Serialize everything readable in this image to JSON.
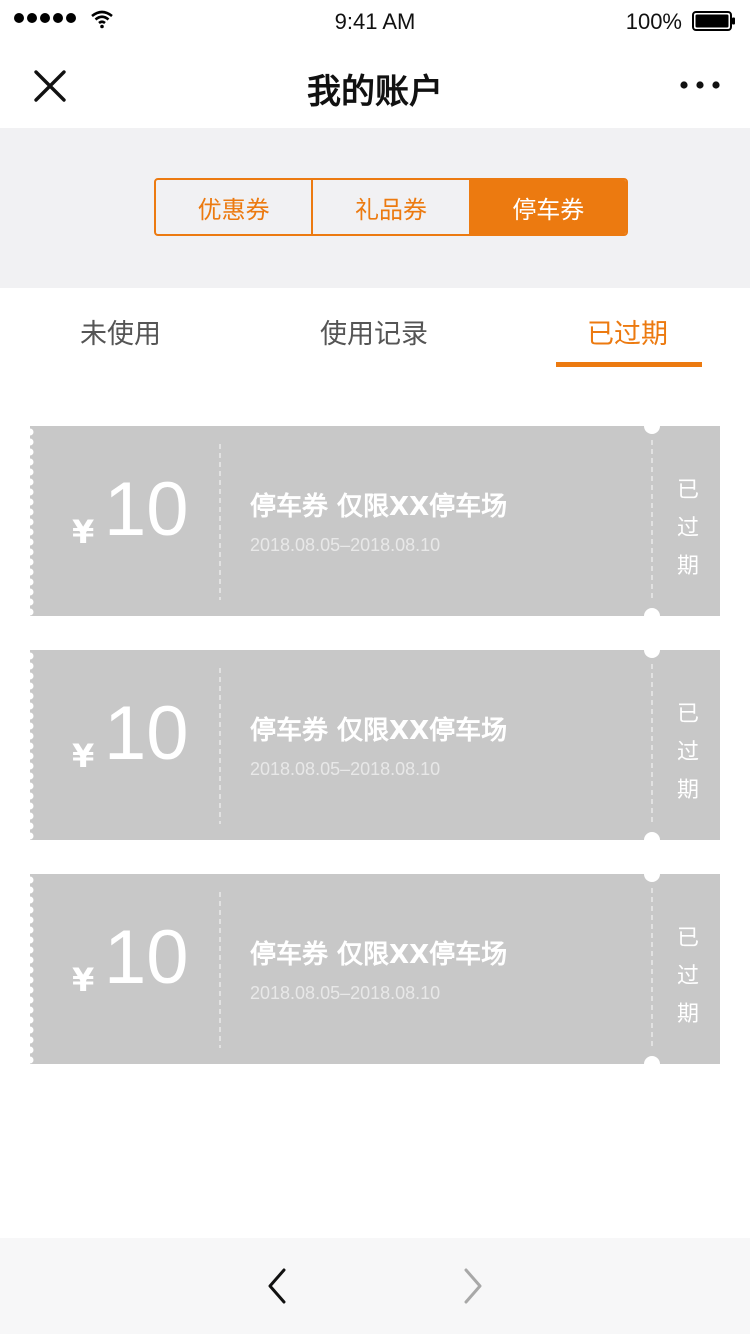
{
  "status_bar": {
    "time": "9:41 AM",
    "battery": "100%"
  },
  "nav": {
    "title": "我的账户"
  },
  "segments": [
    {
      "label": "优惠券",
      "active": false
    },
    {
      "label": "礼品券",
      "active": false
    },
    {
      "label": "停车券",
      "active": true
    }
  ],
  "sub_tabs": [
    {
      "label": "未使用"
    },
    {
      "label": "使用记录"
    },
    {
      "label": "已过期",
      "active": true
    }
  ],
  "coupons": [
    {
      "symbol": "¥",
      "amount": "10",
      "title": "停车券 仅限XX停车场",
      "date": "2018.08.05–2018.08.10",
      "status": [
        "已",
        "过",
        "期"
      ]
    },
    {
      "symbol": "¥",
      "amount": "10",
      "title": "停车券 仅限XX停车场",
      "date": "2018.08.05–2018.08.10",
      "status": [
        "已",
        "过",
        "期"
      ]
    },
    {
      "symbol": "¥",
      "amount": "10",
      "title": "停车券 仅限XX停车场",
      "date": "2018.08.05–2018.08.10",
      "status": [
        "已",
        "过",
        "期"
      ]
    }
  ],
  "colors": {
    "accent": "#ec7a10",
    "coupon_bg": "#c8c8c8",
    "page_gray": "#f1f1f3"
  },
  "icons": {
    "close": "close-icon",
    "more": "more-icon",
    "back": "chevron-left-icon",
    "forward": "chevron-right-icon"
  }
}
